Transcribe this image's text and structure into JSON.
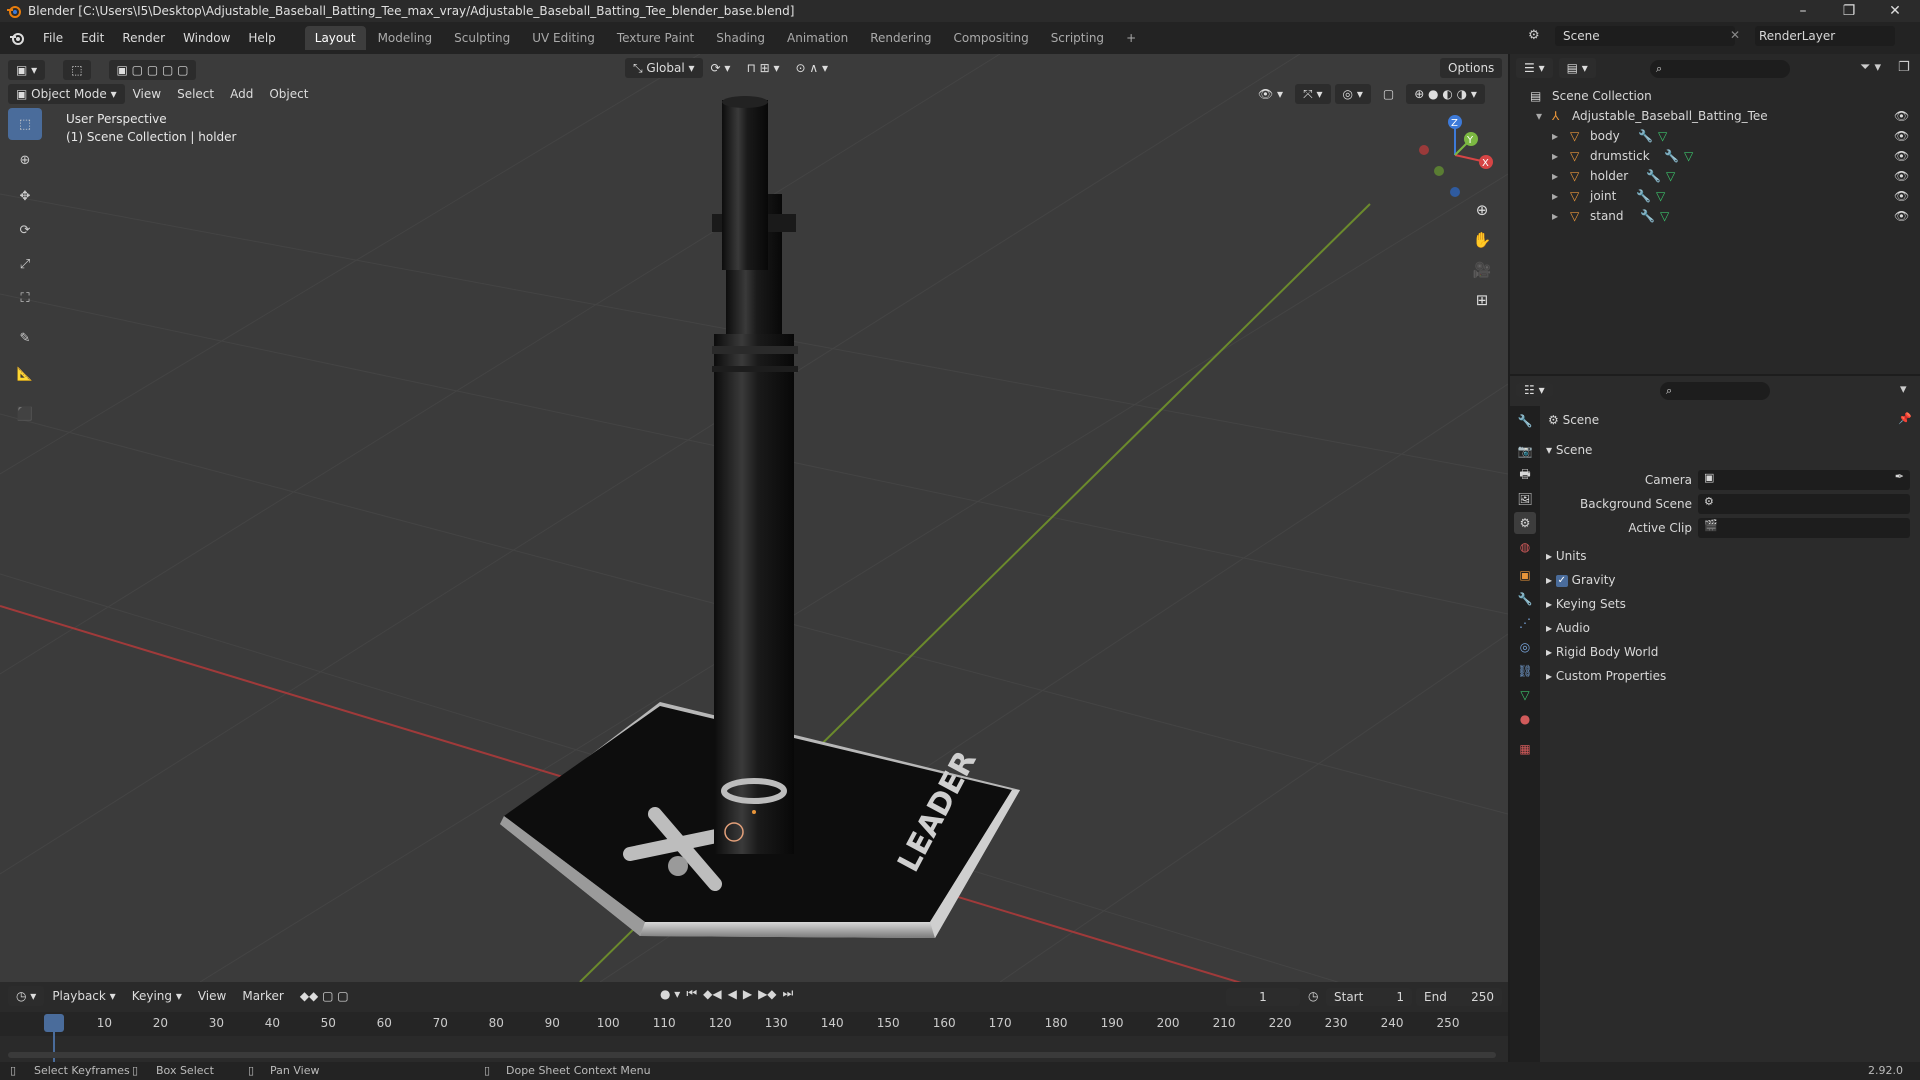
{
  "titlebar": {
    "title": "Blender [C:\\Users\\I5\\Desktop\\Adjustable_Baseball_Batting_Tee_max_vray/Adjustable_Baseball_Batting_Tee_blender_base.blend]",
    "minimize": "–",
    "maximize": "❐",
    "close": "✕"
  },
  "menu": {
    "items": [
      "File",
      "Edit",
      "Render",
      "Window",
      "Help"
    ],
    "workspaces": [
      "Layout",
      "Modeling",
      "Sculpting",
      "UV Editing",
      "Texture Paint",
      "Shading",
      "Animation",
      "Rendering",
      "Compositing",
      "Scripting"
    ],
    "add_workspace": "+",
    "scene": "Scene",
    "render_layer": "RenderLayer"
  },
  "viewport": {
    "mode": "Object Mode",
    "menus": [
      "View",
      "Select",
      "Add",
      "Object"
    ],
    "orientation": "Global",
    "options": "Options",
    "info_line1": "User Perspective",
    "info_line2": "(1) Scene Collection | holder",
    "gizmo": {
      "x": "X",
      "y": "Y",
      "z": "Z"
    },
    "base_text": "LEADER"
  },
  "outliner": {
    "root": "Scene Collection",
    "collection": "Adjustable_Baseball_Batting_Tee",
    "objects": [
      "body",
      "drumstick",
      "holder",
      "joint",
      "stand"
    ]
  },
  "properties": {
    "header": "Scene",
    "panel": "Scene",
    "fields": [
      {
        "label": "Camera"
      },
      {
        "label": "Background Scene"
      },
      {
        "label": "Active Clip"
      }
    ],
    "sections": [
      "Units",
      "Gravity",
      "Keying Sets",
      "Audio",
      "Rigid Body World",
      "Custom Properties"
    ],
    "gravity_checked": true
  },
  "timeline": {
    "menus": [
      "Playback",
      "Keying",
      "View",
      "Marker"
    ],
    "current_frame": "1",
    "start_label": "Start",
    "start": "1",
    "end_label": "End",
    "end": "250",
    "ticks": [
      "1",
      "10",
      "20",
      "30",
      "40",
      "50",
      "60",
      "70",
      "80",
      "90",
      "100",
      "110",
      "120",
      "130",
      "140",
      "150",
      "160",
      "170",
      "180",
      "190",
      "200",
      "210",
      "220",
      "230",
      "240",
      "250"
    ]
  },
  "statusbar": {
    "select": "Select Keyframes",
    "box": "Box Select",
    "pan": "Pan View",
    "context": "Dope Sheet Context Menu",
    "version": "2.92.0"
  },
  "colors": {
    "accent": "#4a6c9b",
    "x_axis": "#d64545",
    "y_axis": "#7cb842",
    "z_axis": "#3d7ad9",
    "object_orange": "#e8953a"
  }
}
